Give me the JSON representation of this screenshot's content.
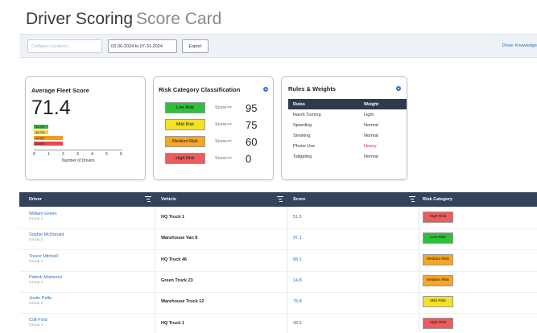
{
  "header": {
    "title": "Driver Scoring",
    "subtitle": "Score Card"
  },
  "toolbar": {
    "search_placeholder": "Configure Locations...",
    "date_range": "03-30-2024 to 07-31-2024",
    "export_label": "Export",
    "link_label": "Driver Knowledge"
  },
  "average_card": {
    "title": "Average Fleet Score",
    "value": "71.4",
    "bars": [
      {
        "label": "19.7%",
        "value": 1,
        "color": "#3cb043"
      },
      {
        "label": "16.7%",
        "value": 1,
        "color": "#f2d23c"
      },
      {
        "label": "24.8%",
        "value": 2,
        "color": "#f39b1f"
      },
      {
        "label": "28.6%",
        "value": 2,
        "color": "#e4484d"
      }
    ],
    "x_ticks": [
      "0",
      "1",
      "2",
      "3",
      "4",
      "5",
      "6"
    ],
    "x_label": "Number of Drivers"
  },
  "risk_card": {
    "title": "Risk Category Classification",
    "rows": [
      {
        "label": "Low Risk",
        "op": "Score>=",
        "value": "95",
        "color": "#2fbf3c"
      },
      {
        "label": "Mild Risk",
        "op": "Score>=",
        "value": "75",
        "color": "#f2e227"
      },
      {
        "label": "Medium Risk",
        "op": "Score>=",
        "value": "60",
        "color": "#f5a623"
      },
      {
        "label": "High Risk",
        "op": "Score>=",
        "value": "0",
        "color": "#ec5b5e"
      }
    ]
  },
  "rules_card": {
    "title": "Rules & Weights",
    "col_rules": "Rules",
    "col_weight": "Weight",
    "rows": [
      {
        "rule": "Harsh Turning",
        "weight": "Light",
        "color": "#333333"
      },
      {
        "rule": "Speeding",
        "weight": "Normal",
        "color": "#333333"
      },
      {
        "rule": "Smoking",
        "weight": "Normal",
        "color": "#333333"
      },
      {
        "rule": "Phone Use",
        "weight": "Heavy",
        "color": "#d62f2f"
      },
      {
        "rule": "Tailgating",
        "weight": "Normal",
        "color": "#333333"
      }
    ]
  },
  "table": {
    "columns": [
      "Driver",
      "Vehicle",
      "Score",
      "Risk Category"
    ],
    "rows": [
      {
        "driver": "William Green",
        "group": "Group 1",
        "vehicle": "HQ Truck 1",
        "score": "51.5",
        "risk": "High Risk",
        "color": "#ec5b5e"
      },
      {
        "driver": "Sophie McDonald",
        "group": "Group 1",
        "vehicle": "Warehouse Van 8",
        "score": "97.1",
        "risk": "Low Risk",
        "color": "#2fbf3c"
      },
      {
        "driver": "Trevor Mitchell",
        "group": "Group 1",
        "vehicle": "HQ Truck 46",
        "score": "68.1",
        "risk": "Medium Risk",
        "color": "#f5a623"
      },
      {
        "driver": "Patrick Martenez",
        "group": "Group 1",
        "vehicle": "Green Truck 23",
        "score": "14.8",
        "risk": "Medium Risk",
        "color": "#f5a623"
      },
      {
        "driver": "Justin Pelle",
        "group": "Group 1",
        "vehicle": "Warehouse Truck 12",
        "score": "75.8",
        "risk": "Mild Risk",
        "color": "#f2e227"
      },
      {
        "driver": "Colt Ford",
        "group": "Group 1",
        "vehicle": "HQ Truck 1",
        "score": "38.5",
        "risk": "High Risk",
        "color": "#ec5b5e"
      }
    ]
  }
}
